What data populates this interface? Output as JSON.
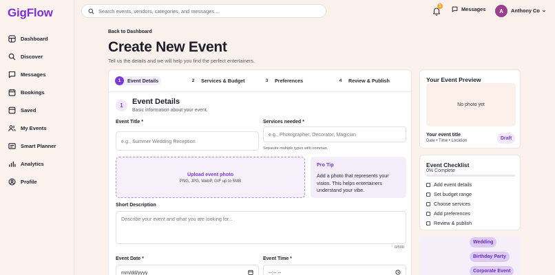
{
  "app": {
    "logo": "GigFlow"
  },
  "sidebar": {
    "items": [
      {
        "label": "Dashboard",
        "icon": "dashboard-icon"
      },
      {
        "label": "Discover",
        "icon": "search-icon"
      },
      {
        "label": "Messages",
        "icon": "chat-icon"
      },
      {
        "label": "Bookings",
        "icon": "calendar-icon"
      },
      {
        "label": "Saved",
        "icon": "bookmark-icon"
      },
      {
        "label": "My Events",
        "icon": "users-icon"
      },
      {
        "label": "Smart Planner",
        "icon": "planner-icon"
      },
      {
        "label": "Analytics",
        "icon": "bar-chart-icon"
      },
      {
        "label": "Profile",
        "icon": "user-icon"
      }
    ]
  },
  "topbar": {
    "search_placeholder": "Search events, vendors, categories, and messages...",
    "notification_count": "1",
    "messages_label": "Messages",
    "avatar_initial": "A",
    "user_name": "Anthony Co"
  },
  "header": {
    "back_label": "Back to Dashboard",
    "title": "Create New Event",
    "subtitle": "Tell us the details and we will help you find the perfect entertainers."
  },
  "steps": [
    {
      "num": "1",
      "label": "Event Details",
      "active": true
    },
    {
      "num": "2",
      "label": "Services & Budget",
      "active": false
    },
    {
      "num": "3",
      "label": "Preferences",
      "active": false
    },
    {
      "num": "4",
      "label": "Review & Publish",
      "active": false
    }
  ],
  "section": {
    "num": "1",
    "title": "Event Details",
    "subtitle": "Basic information about your event."
  },
  "form": {
    "event_title_label": "Event Title *",
    "event_title_placeholder": "e.g., Summer Wedding Reception",
    "services_label": "Services needed *",
    "services_placeholder": "e.g., Photographer, Decorator, Magician",
    "services_hint": "Separate multiple types with commas.",
    "upload_title": "Upload event photo",
    "upload_types": "PNG, JPG, WebP, GIF up to 5MB",
    "tip_title": "Pro Tip",
    "tip_text": "Add a photo that represents your vision. This helps entertainers understand your vibe.",
    "description_label": "Short Description",
    "description_placeholder": "Describe your event and what you are looking for...",
    "description_counter": "0/500",
    "date_label": "Event Date *",
    "date_placeholder": "mm/dd/yyyy",
    "time_label": "Event Time *",
    "time_placeholder": "--:-- --"
  },
  "preview": {
    "title": "Your Event Preview",
    "photo_placeholder": "No photo yet",
    "event_title": "Your event title",
    "meta": "Date • Time • Location",
    "status": "Draft"
  },
  "checklist": {
    "title": "Event Checklist",
    "progress_label": "0% Complete",
    "progress_fraction": 0,
    "items": [
      "Add event details",
      "Set budget range",
      "Choose services",
      "Add preferences",
      "Review & publish"
    ]
  },
  "event_types": [
    "Wedding",
    "Birthday Party",
    "Corporate Event"
  ],
  "colors": {
    "accent": "#7c3ad6",
    "brand": "#7c2fd6",
    "badge": "#f7a531",
    "avatar": "#9b3f8c"
  }
}
